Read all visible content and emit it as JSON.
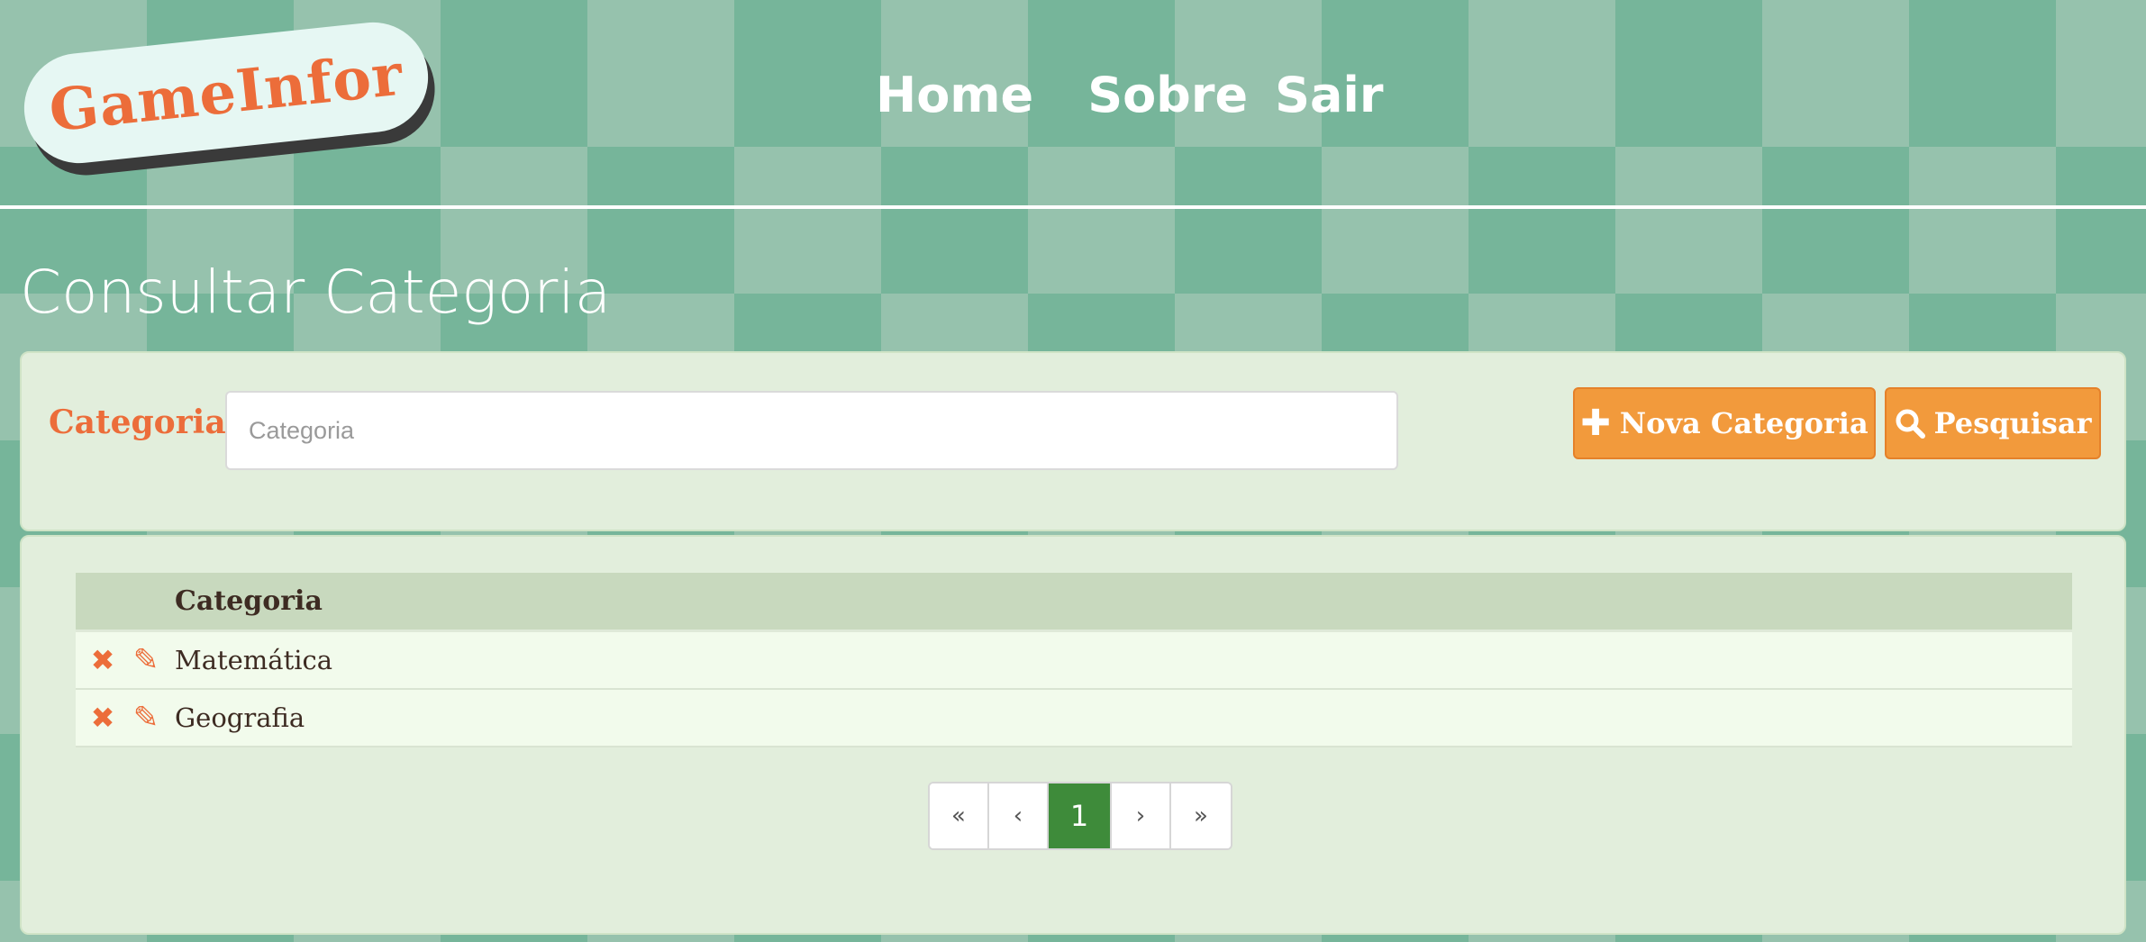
{
  "logo": {
    "text": "GameInfor"
  },
  "nav": {
    "items": [
      "Home",
      "Sobre",
      "Sair"
    ]
  },
  "page_title": "Consultar Categoria",
  "search": {
    "label": "Categoria:",
    "placeholder": "Categoria",
    "value": "",
    "new_button_label": "Nova Categoria",
    "search_button_label": "Pesquisar"
  },
  "table": {
    "column_header": "Categoria",
    "rows": [
      "Matemática",
      "Geografia"
    ]
  },
  "pagination": {
    "first": "«",
    "prev": "‹",
    "current": "1",
    "next": "›",
    "last": "»"
  },
  "colors": {
    "accent": "#ec6d3a",
    "button": "#f29a3c",
    "active_page": "#3e8b3a"
  },
  "icons": {
    "new": "plus-icon",
    "search": "magnifier-icon",
    "delete": "x-icon",
    "edit": "pencil-icon"
  }
}
